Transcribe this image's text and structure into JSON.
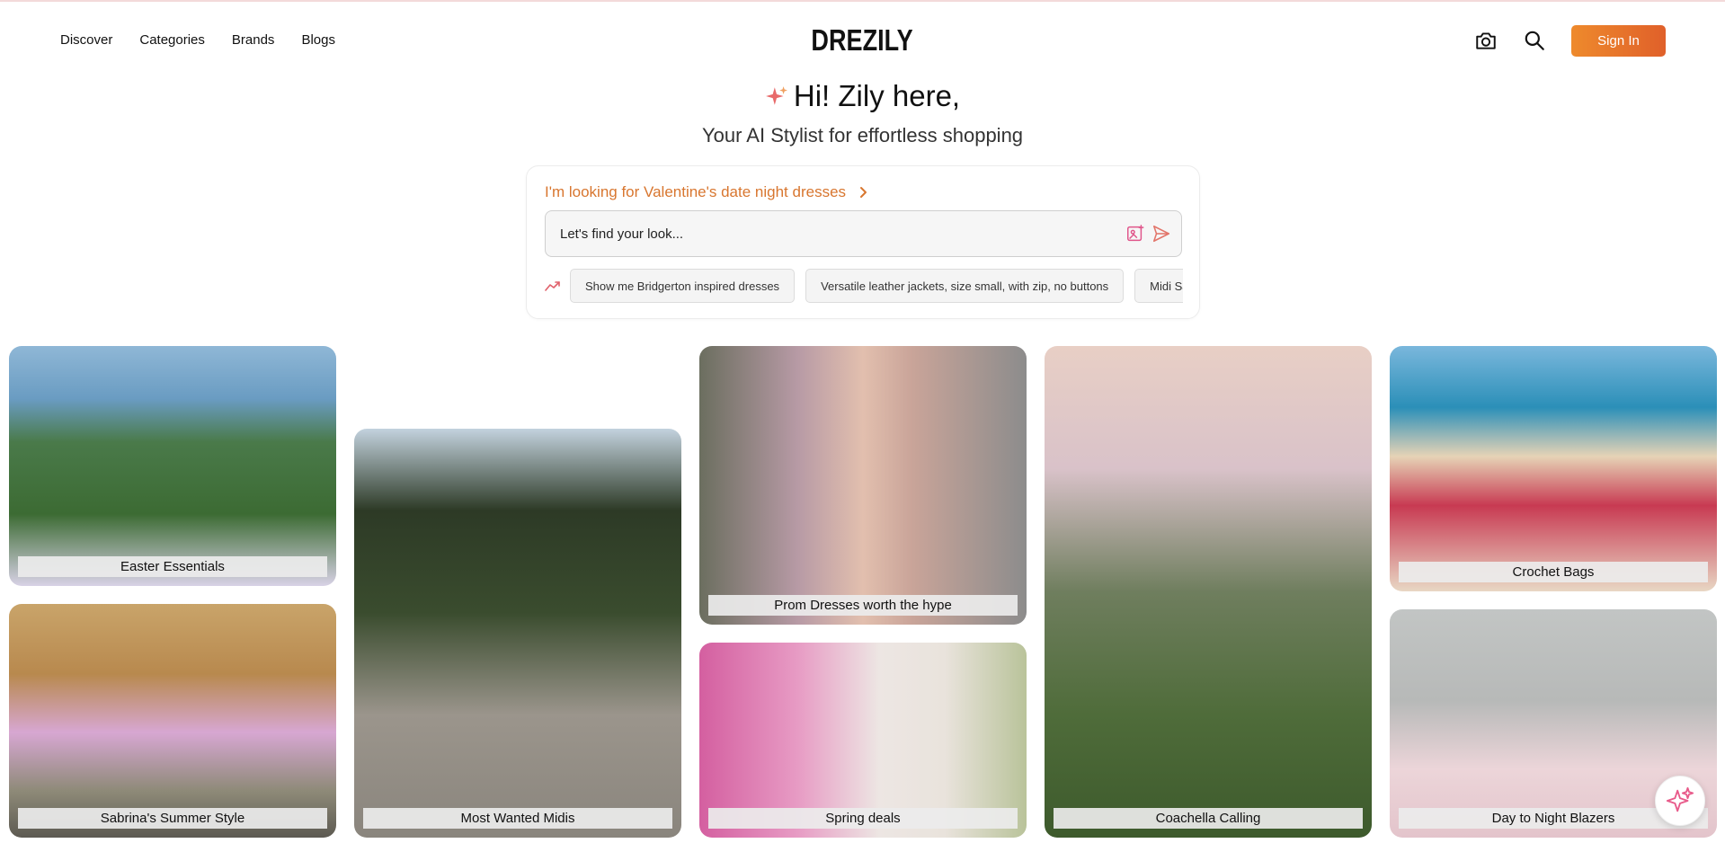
{
  "header": {
    "nav": [
      "Discover",
      "Categories",
      "Brands",
      "Blogs"
    ],
    "logo": "DREZILY",
    "signin_label": "Sign In"
  },
  "hero": {
    "title": "Hi! Zily here,",
    "subtitle": "Your AI Stylist for effortless shopping"
  },
  "chat": {
    "suggestion": "I'm looking for Valentine's date night dresses",
    "input_placeholder": "Let's find your look...",
    "trending": [
      "Show me Bridgerton inspired dresses",
      "Versatile leather jackets, size small, with zip, no buttons",
      "Midi Sa"
    ]
  },
  "cards": [
    {
      "label": "Easter Essentials"
    },
    {
      "label": "Sabrina's Summer Style"
    },
    {
      "label": "Most Wanted Midis"
    },
    {
      "label": "Prom Dresses worth the hype"
    },
    {
      "label": "Spring deals"
    },
    {
      "label": "Coachella Calling"
    },
    {
      "label": "Crochet Bags"
    },
    {
      "label": "Day to Night Blazers"
    }
  ],
  "colors": {
    "accent_orange": "#e8762c",
    "suggestion_text": "#d8762f",
    "sparkle_pink": "#e85a8a"
  },
  "icons": {
    "camera": "camera-icon",
    "search": "search-icon",
    "sparkle": "sparkle-icon",
    "image_upload": "image-upload-icon",
    "send": "send-icon",
    "trending": "trending-icon"
  }
}
